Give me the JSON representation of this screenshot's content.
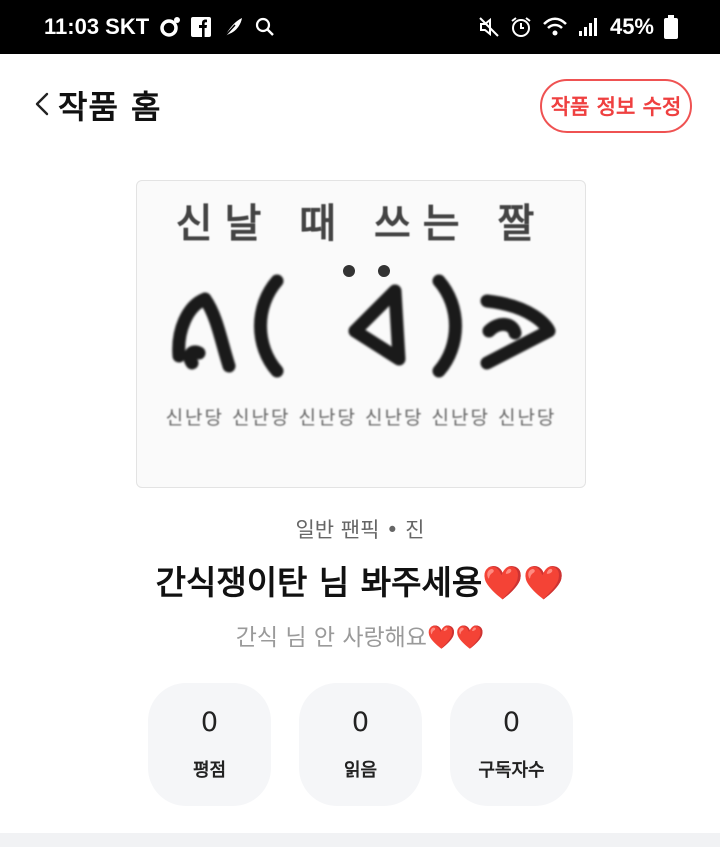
{
  "status_bar": {
    "time_carrier": "11:03 SKT",
    "battery": "45%",
    "left_icons": [
      "notification-dot-icon",
      "facebook-icon",
      "feather-icon",
      "search-icon"
    ],
    "right_icons": [
      "mute-icon",
      "alarm-icon",
      "wifi-icon",
      "signal-icon",
      "battery-icon"
    ]
  },
  "header": {
    "title": "작품 홈",
    "edit_button": "작품 정보 수정",
    "back_icon": "chevron-left-icon"
  },
  "cover": {
    "top_text": "신날 때 쓰는 짤",
    "face_text": "ᕱ( ᐛ )ᕱ",
    "bottom_text": "신난당 신난당 신난당 신난당 신난당 신난당"
  },
  "work": {
    "category": "일반 팬픽 • 진",
    "title": "간식쟁이탄 님 봐주세용❤️❤️",
    "subtitle": "간식 님 안 사랑해요❤️❤️"
  },
  "stats": [
    {
      "value": "0",
      "label": "평점"
    },
    {
      "value": "0",
      "label": "읽음"
    },
    {
      "value": "0",
      "label": "구독자수"
    }
  ],
  "colors": {
    "accent": "#ef4040",
    "stat_bg": "#f5f6f8",
    "subtitle": "#9a9a9a"
  }
}
